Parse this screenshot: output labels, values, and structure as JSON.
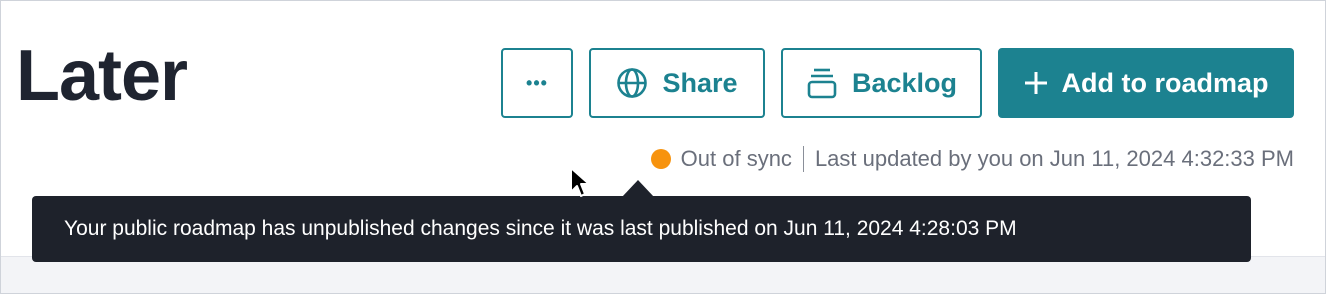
{
  "header": {
    "title": "Later"
  },
  "toolbar": {
    "more_label": "•••",
    "share_label": "Share",
    "backlog_label": "Backlog",
    "add_label": "Add to roadmap"
  },
  "status": {
    "sync_text": "Out of sync",
    "updated_text": "Last updated by you on Jun 11, 2024 4:32:33 PM",
    "dot_color": "#f7930e"
  },
  "tooltip": {
    "text": "Your public roadmap has unpublished changes since it was last published on Jun 11, 2024 4:28:03 PM"
  },
  "theme": {
    "accent": "#1c8290",
    "title_color": "#1f2430",
    "tooltip_bg": "#1e222b"
  },
  "icons": {
    "more": "ellipsis-icon",
    "share": "globe-icon",
    "backlog": "stack-icon",
    "add": "plus-icon",
    "status": "status-dot-icon",
    "cursor": "mouse-cursor-icon"
  }
}
